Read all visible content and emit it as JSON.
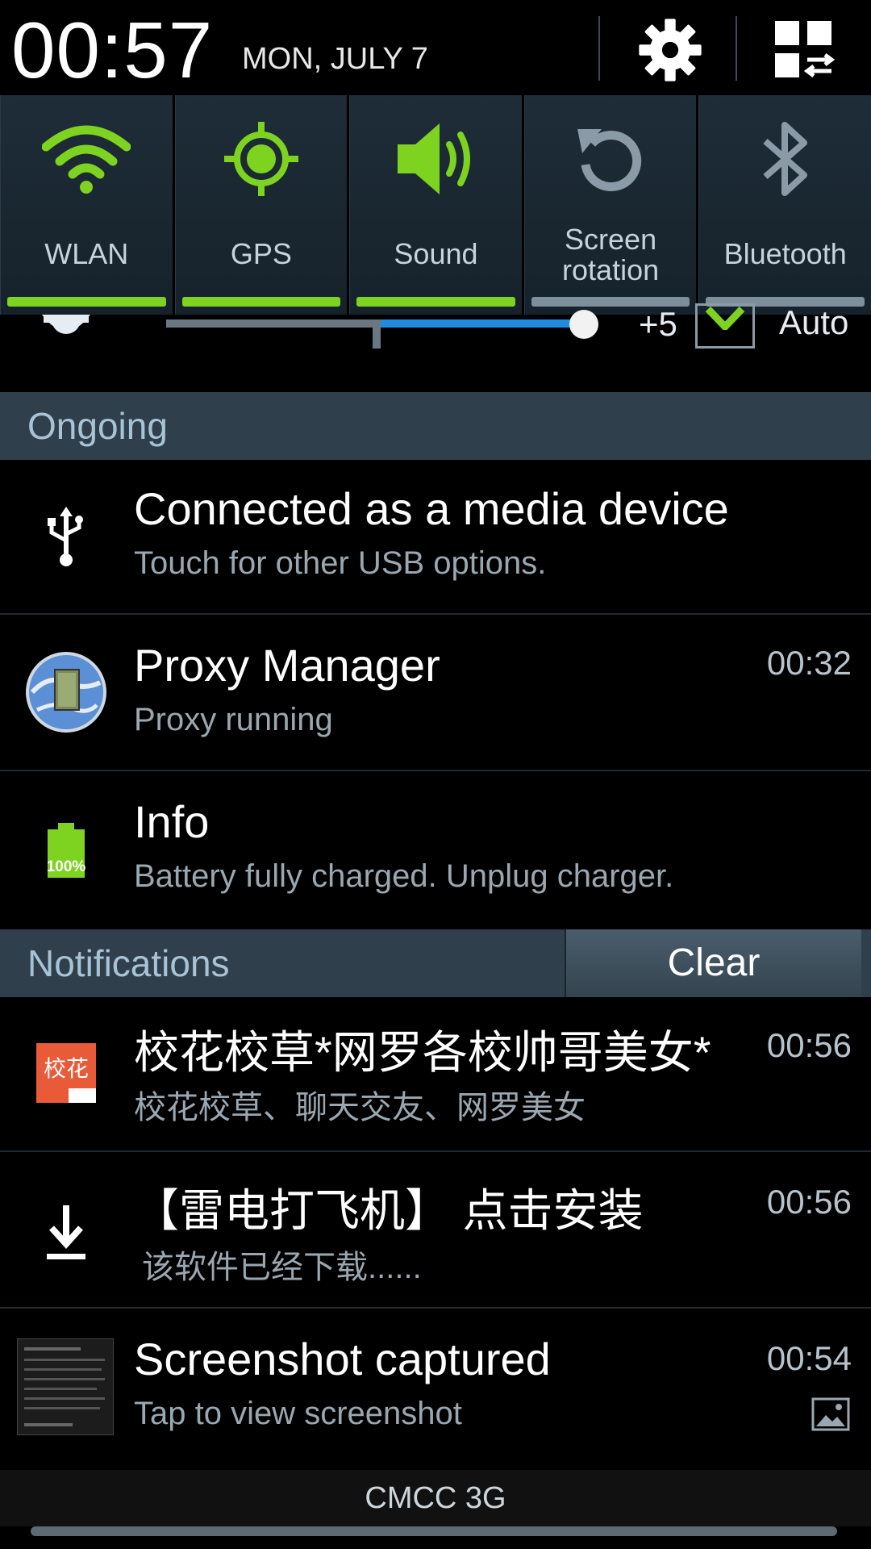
{
  "status": {
    "time": "00:57",
    "date": "MON, JULY 7"
  },
  "icons": {
    "settings": "gear-icon",
    "quick_panel": "grid-swap-icon"
  },
  "quick_toggles": [
    {
      "label": "WLAN",
      "icon": "wifi-icon",
      "on": true
    },
    {
      "label": "GPS",
      "icon": "gps-icon",
      "on": true
    },
    {
      "label": "Sound",
      "icon": "speaker-icon",
      "on": true
    },
    {
      "label": "Screen\nrotation",
      "icon": "rotation-icon",
      "on": false
    },
    {
      "label": "Bluetooth",
      "icon": "bluetooth-icon",
      "on": false
    }
  ],
  "brightness": {
    "offset_label": "+5",
    "auto_label": "Auto",
    "auto_checked": true
  },
  "sections": {
    "ongoing": "Ongoing",
    "notifications": "Notifications",
    "clear_label": "Clear"
  },
  "ongoing": [
    {
      "title": "Connected as a media device",
      "subtitle": "Touch for other USB options.",
      "time": "",
      "icon": "usb-icon"
    },
    {
      "title": "Proxy Manager",
      "subtitle": "Proxy running",
      "time": "00:32",
      "icon": "globe-door-icon"
    },
    {
      "title": "Info",
      "subtitle": "Battery fully charged. Unplug charger.",
      "time": "",
      "icon": "battery-full-icon",
      "battery_text": "100%"
    }
  ],
  "notifications": [
    {
      "title": "校花校草*网罗各校帅哥美女*",
      "subtitle": "校花校草、聊天交友、网罗美女",
      "time": "00:56",
      "icon": "app-logo-icon",
      "logo_text": "校花"
    },
    {
      "title": "【雷电打飞机】 点击安装",
      "subtitle": "该软件已经下载......",
      "time": "00:56",
      "icon": "download-icon"
    },
    {
      "title": "Screenshot captured",
      "subtitle": "Tap to view screenshot",
      "time": "00:54",
      "icon": "screenshot-thumbnail-icon"
    }
  ],
  "carrier": "CMCC 3G",
  "colors": {
    "accent_on": "#7ed321",
    "section_bg": "#2f3f4b",
    "section_text": "#a9c3d6"
  }
}
